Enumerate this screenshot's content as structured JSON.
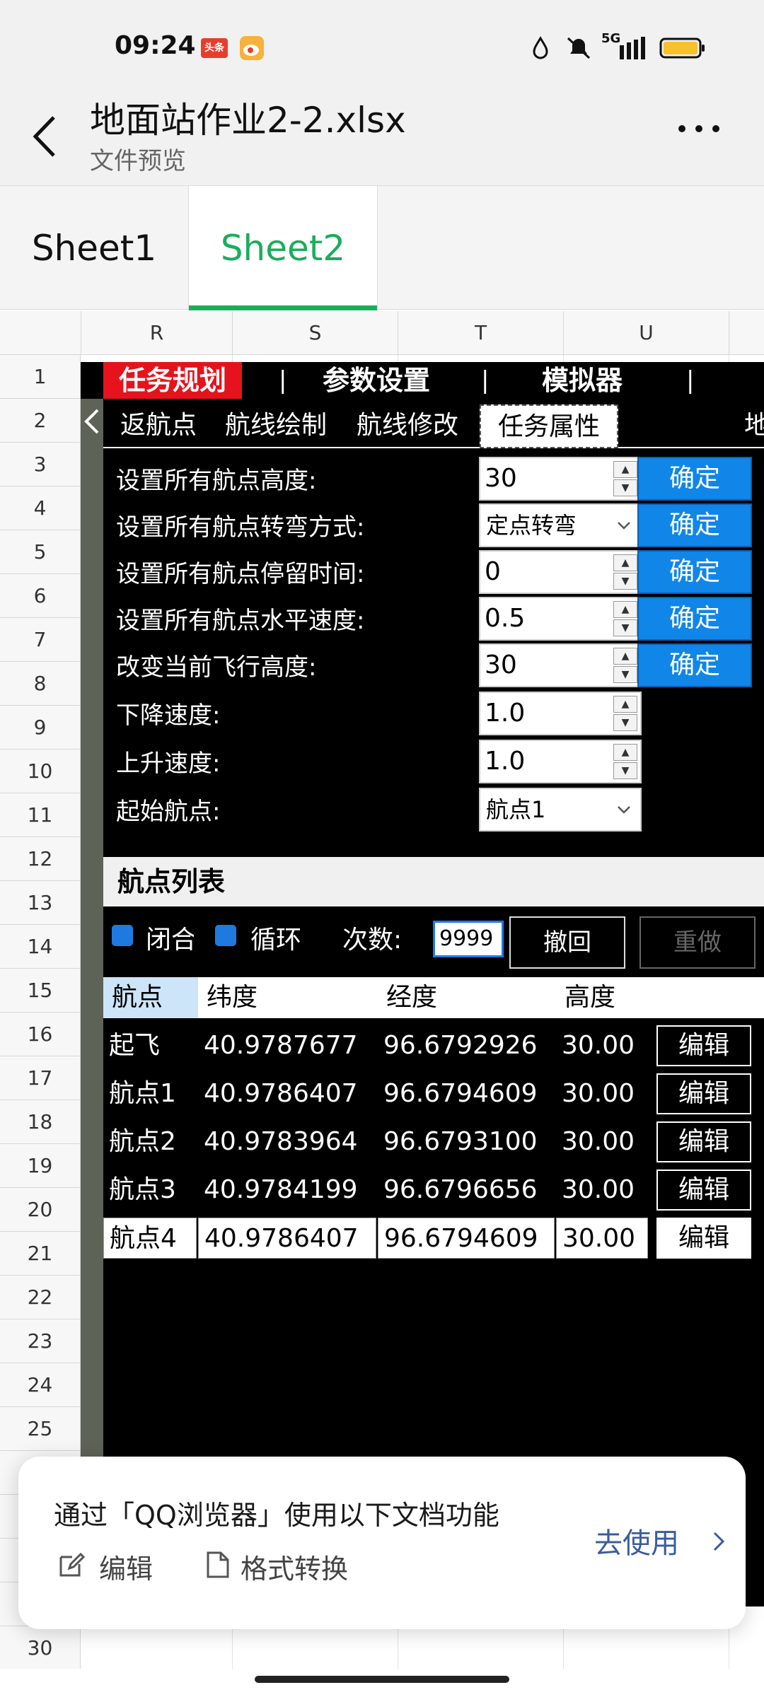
{
  "status_bar": {
    "time": "09:24",
    "app_badge_1": "头条",
    "app_badge_2_icon": "weibo-icon",
    "network": "5G"
  },
  "header": {
    "title": "地面站作业2-2.xlsx",
    "subtitle": "文件预览"
  },
  "sheet_tabs": [
    {
      "label": "Sheet1",
      "active": false
    },
    {
      "label": "Sheet2",
      "active": true
    }
  ],
  "colors": {
    "accent_green": "#1aad5b",
    "app_red": "#e6131c",
    "confirm_blue": "#0f86e8",
    "link_blue": "#3a5c9c"
  },
  "columns": [
    "R",
    "S",
    "T",
    "U"
  ],
  "rows": [
    "1",
    "2",
    "3",
    "4",
    "5",
    "6",
    "7",
    "8",
    "9",
    "10",
    "11",
    "12",
    "13",
    "14",
    "15",
    "16",
    "17",
    "18",
    "19",
    "20",
    "21",
    "22",
    "23",
    "24",
    "25",
    "30"
  ],
  "embedded_app": {
    "menu": [
      "任务规划",
      "参数设置",
      "模拟器"
    ],
    "menu_sep": "|",
    "subtabs": [
      "返航点",
      "航线绘制",
      "航线修改",
      "任务属性",
      "地"
    ],
    "form": [
      {
        "label": "设置所有航点高度:",
        "value": "30",
        "type": "spin",
        "confirm": "确定"
      },
      {
        "label": "设置所有航点转弯方式:",
        "value": "定点转弯",
        "type": "select",
        "confirm": "确定"
      },
      {
        "label": "设置所有航点停留时间:",
        "value": "0",
        "type": "spin",
        "confirm": "确定"
      },
      {
        "label": "设置所有航点水平速度:",
        "value": "0.5",
        "type": "spin",
        "confirm": "确定"
      },
      {
        "label": "改变当前飞行高度:",
        "value": "30",
        "type": "spin",
        "confirm": "确定"
      },
      {
        "label": "下降速度:",
        "value": "1.0",
        "type": "spin"
      },
      {
        "label": "上升速度:",
        "value": "1.0",
        "type": "spin"
      },
      {
        "label": "起始航点:",
        "value": "航点1",
        "type": "select"
      }
    ],
    "waypoint_list": {
      "title": "航点列表",
      "close_label": "闭合",
      "loop_label": "循环",
      "count_label": "次数:",
      "count_value": "9999",
      "undo": "撤回",
      "redo": "重做",
      "headers": [
        "航点",
        "纬度",
        "经度",
        "高度"
      ],
      "edit_label": "编辑",
      "rows": [
        {
          "name": "起飞",
          "lat": "40.9787677",
          "lon": "96.6792926",
          "alt": "30.00"
        },
        {
          "name": "航点1",
          "lat": "40.9786407",
          "lon": "96.6794609",
          "alt": "30.00"
        },
        {
          "name": "航点2",
          "lat": "40.9783964",
          "lon": "96.6793100",
          "alt": "30.00"
        },
        {
          "name": "航点3",
          "lat": "40.9784199",
          "lon": "96.6796656",
          "alt": "30.00"
        },
        {
          "name": "航点4",
          "lat": "40.9786407",
          "lon": "96.6794609",
          "alt": "30.00"
        }
      ]
    }
  },
  "popup": {
    "text": "通过「QQ浏览器」使用以下文档功能",
    "edit": "编辑",
    "convert": "格式转换",
    "go": "去使用"
  }
}
